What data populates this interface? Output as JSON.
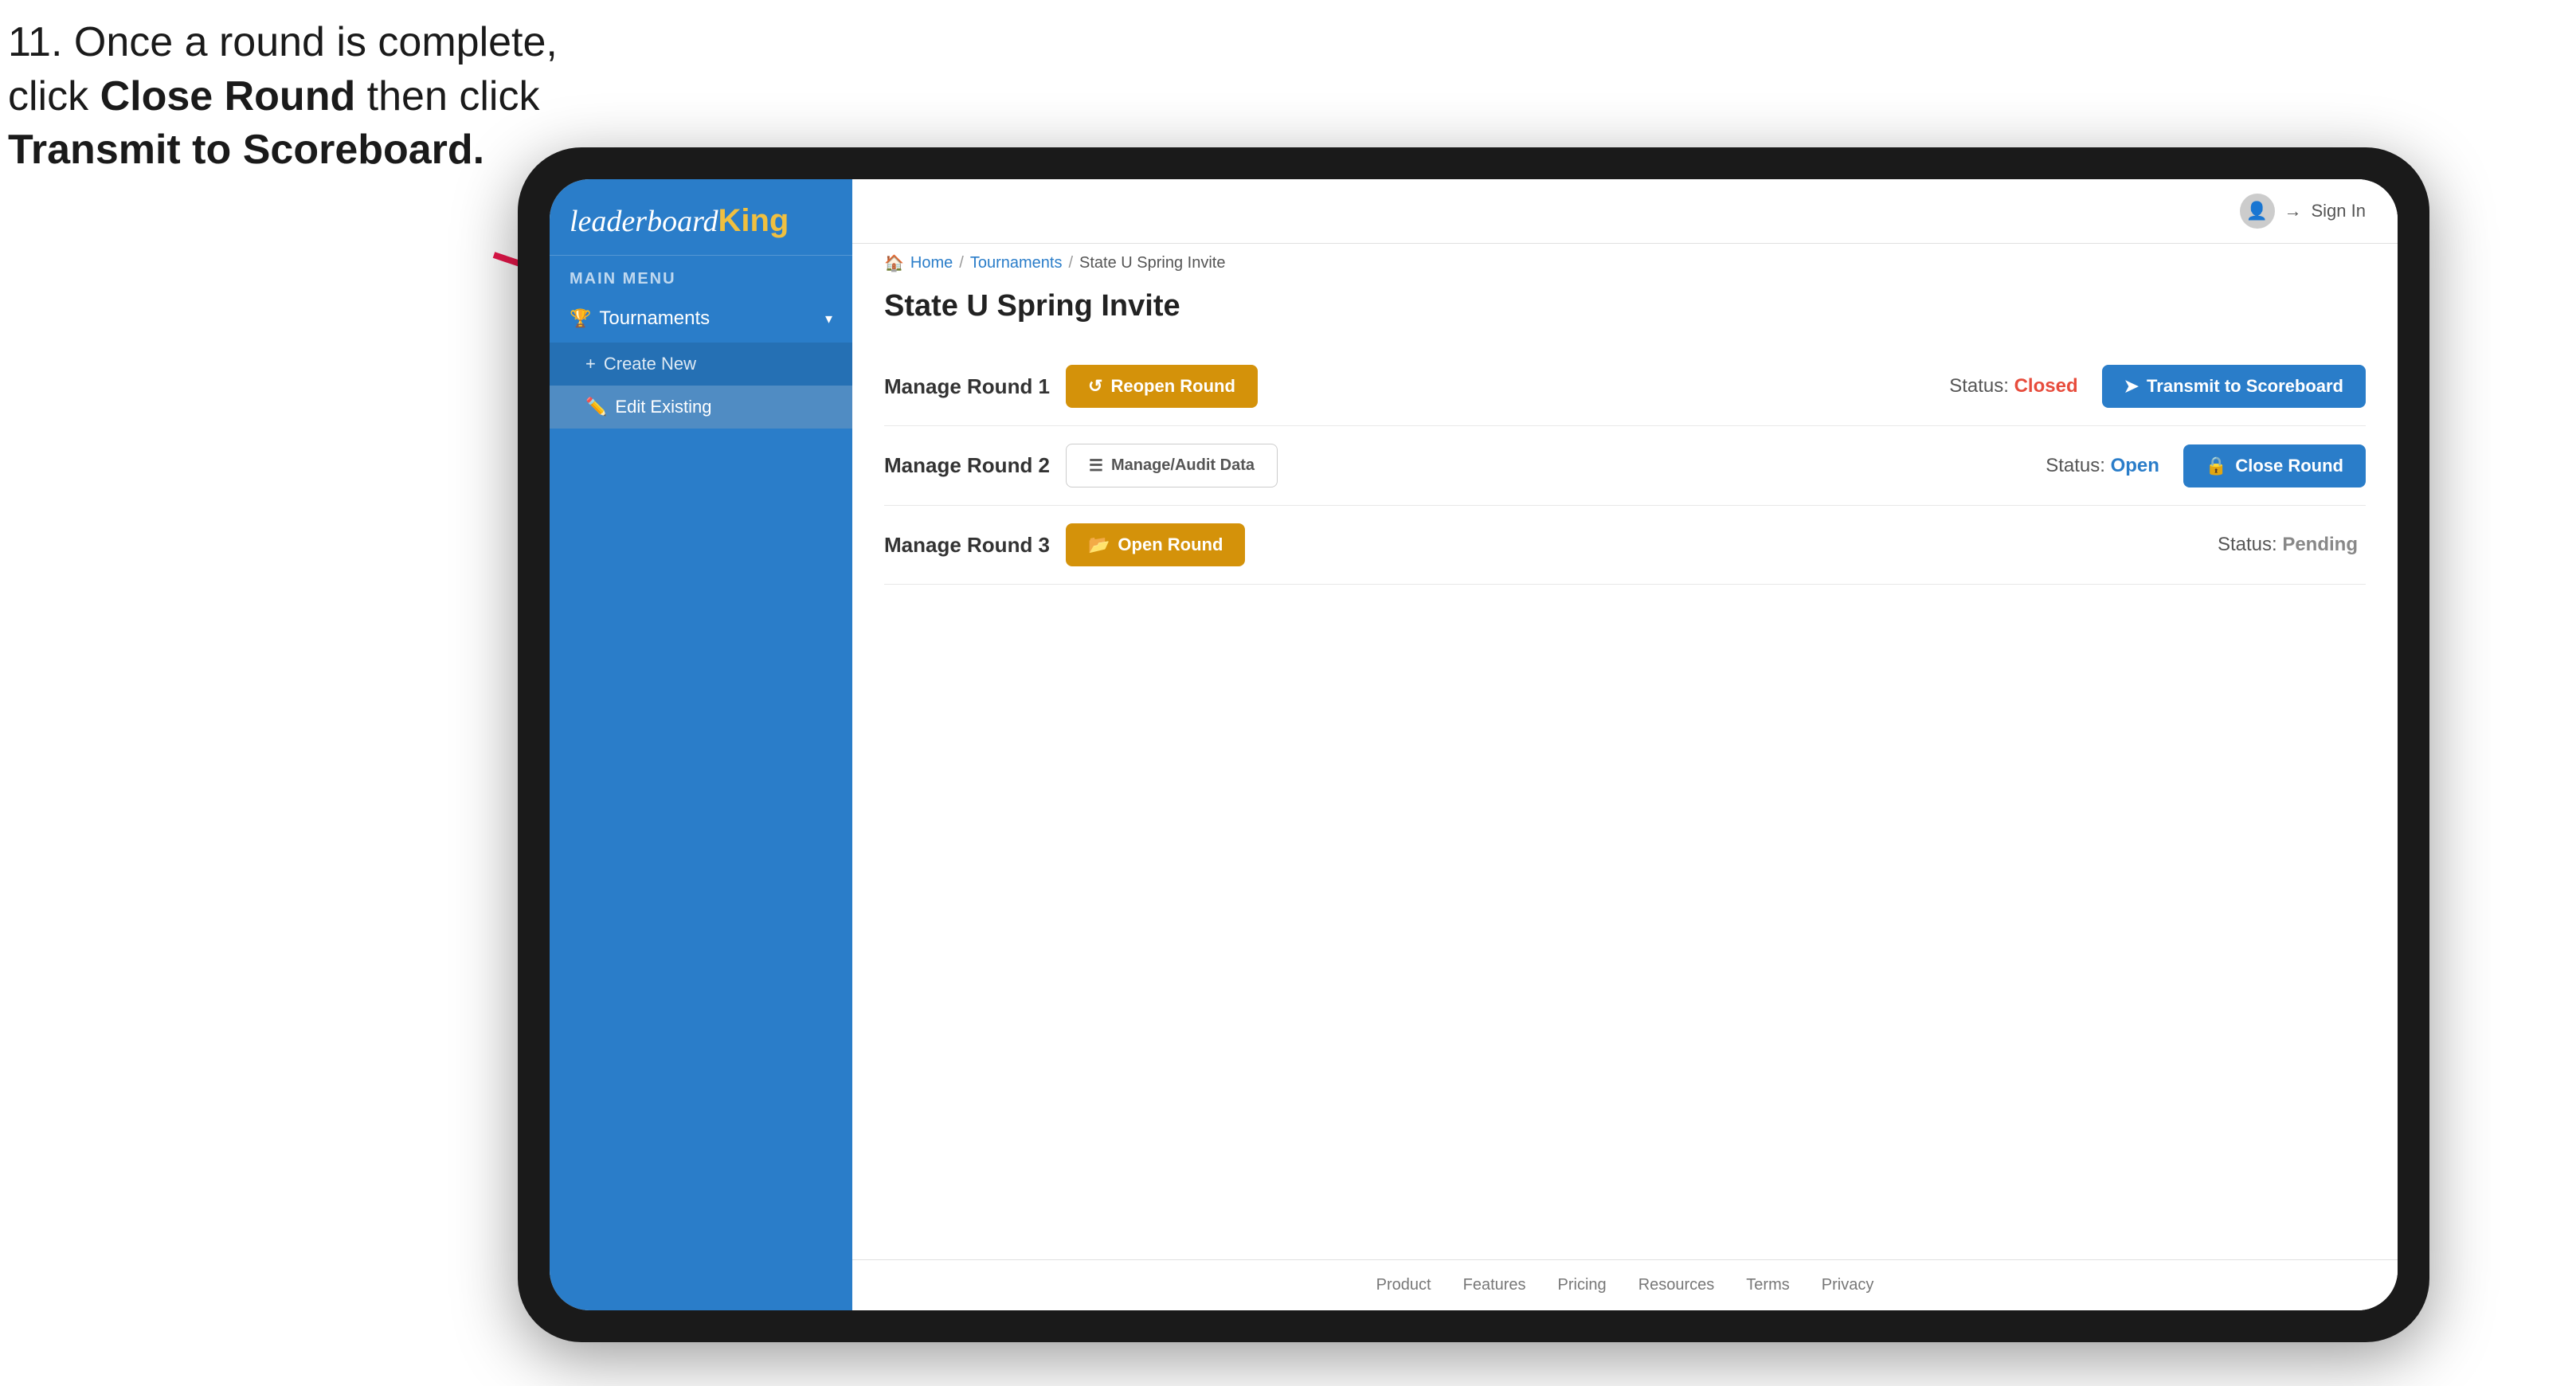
{
  "instruction": {
    "line1": "11. Once a round is complete,",
    "line2": "click ",
    "bold1": "Close Round",
    "line3": " then click",
    "bold2": "Transmit to Scoreboard."
  },
  "sidebar": {
    "logo": "leaderboard",
    "logo_king": "King",
    "main_menu_label": "MAIN MENU",
    "nav_items": [
      {
        "id": "tournaments",
        "icon": "🏆",
        "label": "Tournaments",
        "expanded": true
      }
    ],
    "sub_items": [
      {
        "id": "create-new",
        "icon": "+",
        "label": "Create New"
      },
      {
        "id": "edit-existing",
        "icon": "✏️",
        "label": "Edit Existing",
        "selected": true
      }
    ]
  },
  "topnav": {
    "sign_in_label": "Sign In"
  },
  "breadcrumb": {
    "home": "Home",
    "sep1": "/",
    "tournaments": "Tournaments",
    "sep2": "/",
    "current": "State U Spring Invite"
  },
  "page": {
    "title": "State U Spring Invite",
    "rounds": [
      {
        "id": "round1",
        "title": "Manage Round 1",
        "status_label": "Status:",
        "status_value": "Closed",
        "status_class": "status-closed",
        "primary_btn": {
          "label": "Reopen Round",
          "icon": "↺",
          "style": "btn-amber"
        },
        "secondary_btn": {
          "label": "Transmit to Scoreboard",
          "icon": "➤",
          "style": "btn-blue"
        }
      },
      {
        "id": "round2",
        "title": "Manage Round 2",
        "status_label": "Status:",
        "status_value": "Open",
        "status_class": "status-open",
        "primary_btn": {
          "label": "Manage/Audit Data",
          "icon": "☰",
          "style": "btn-outline"
        },
        "secondary_btn": {
          "label": "Close Round",
          "icon": "🔒",
          "style": "btn-blue"
        }
      },
      {
        "id": "round3",
        "title": "Manage Round 3",
        "status_label": "Status:",
        "status_value": "Pending",
        "status_class": "status-pending",
        "primary_btn": {
          "label": "Open Round",
          "icon": "📂",
          "style": "btn-amber"
        },
        "secondary_btn": null
      }
    ]
  },
  "footer": {
    "links": [
      "Product",
      "Features",
      "Pricing",
      "Resources",
      "Terms",
      "Privacy"
    ]
  }
}
